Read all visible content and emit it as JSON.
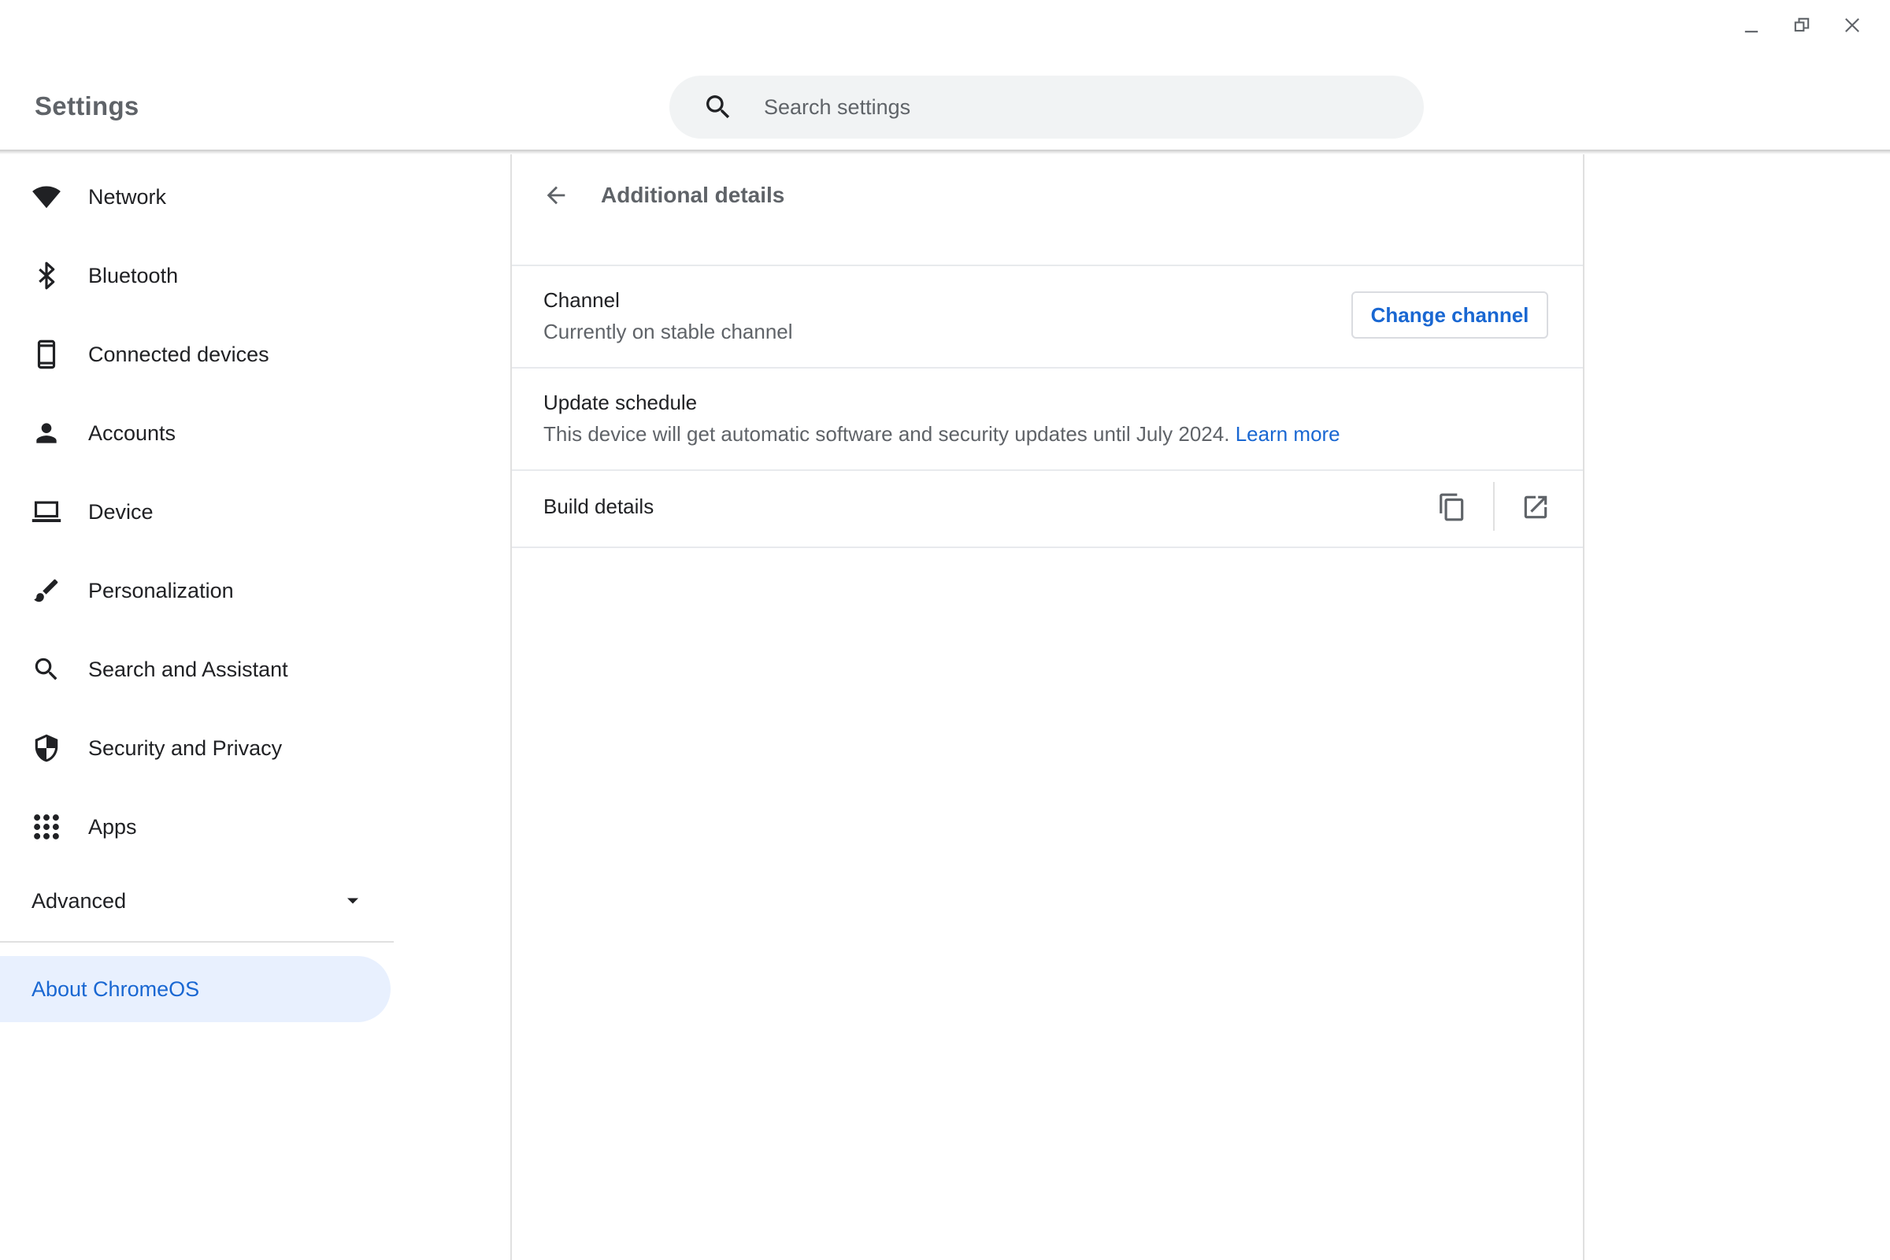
{
  "window": {
    "controls": [
      {
        "name": "minimize-icon"
      },
      {
        "name": "restore-icon"
      },
      {
        "name": "close-icon"
      }
    ]
  },
  "header": {
    "title": "Settings",
    "search": {
      "placeholder": "Search settings"
    }
  },
  "sidebar": {
    "items": [
      {
        "label": "Network",
        "icon": "wifi-icon"
      },
      {
        "label": "Bluetooth",
        "icon": "bluetooth-icon"
      },
      {
        "label": "Connected devices",
        "icon": "phone-icon"
      },
      {
        "label": "Accounts",
        "icon": "person-icon"
      },
      {
        "label": "Device",
        "icon": "laptop-icon"
      },
      {
        "label": "Personalization",
        "icon": "brush-icon"
      },
      {
        "label": "Search and Assistant",
        "icon": "search-icon"
      },
      {
        "label": "Security and Privacy",
        "icon": "shield-icon"
      },
      {
        "label": "Apps",
        "icon": "apps-grid-icon"
      }
    ],
    "advanced": {
      "label": "Advanced",
      "icon": "arrow-drop-down-icon"
    },
    "about": {
      "label": "About ChromeOS",
      "selected": true
    }
  },
  "main": {
    "page_title": "Additional details",
    "channel": {
      "title": "Channel",
      "subtitle": "Currently on stable channel",
      "button_label": "Change channel"
    },
    "update_schedule": {
      "title": "Update schedule",
      "subtitle": "This device will get automatic software and security updates until July 2024.",
      "link": "Learn more"
    },
    "build_details": {
      "title": "Build details",
      "actions": [
        {
          "name": "copy-icon"
        },
        {
          "name": "open-in-new-icon"
        }
      ]
    }
  },
  "colors": {
    "accent": "#1967d2",
    "selected_bg": "#e8f0fe",
    "search_bg": "#f1f3f4",
    "secondary_text": "#5f6368"
  }
}
